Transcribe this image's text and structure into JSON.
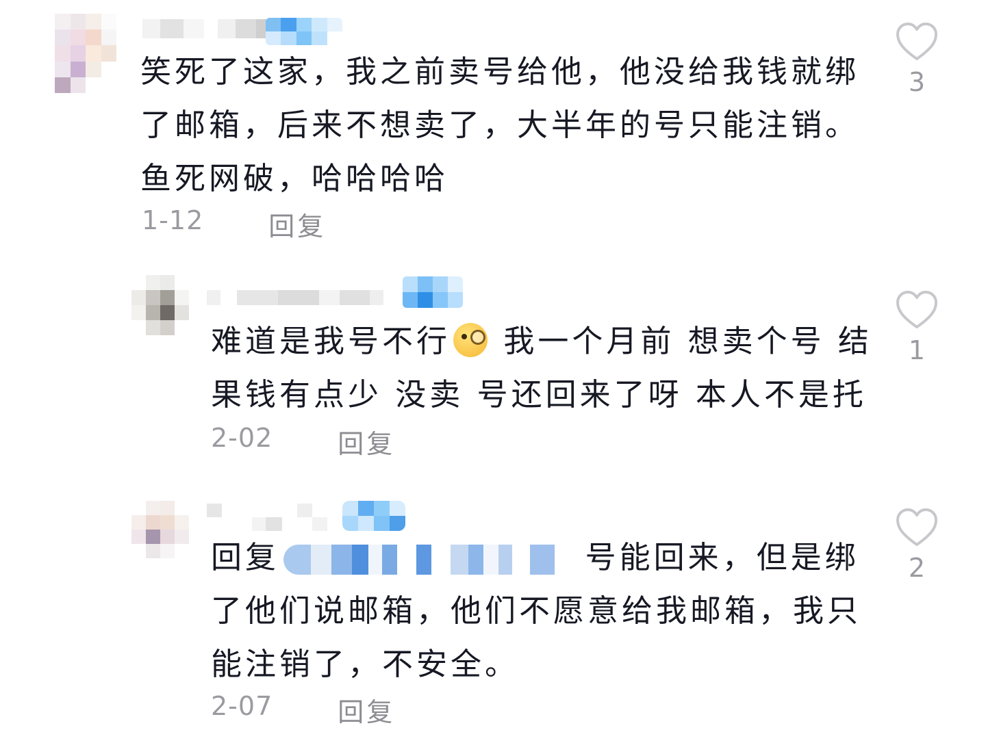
{
  "colors": {
    "text": "#161823",
    "meta": "#9a9aa0",
    "heart": "#c8c8cc",
    "mention_blur": "#3d86e0"
  },
  "comments": [
    {
      "text": "笑死了这家，我之前卖号给他，他没给我钱就绑了邮箱，后来不想卖了，大半年的号只能注销。鱼死网破，哈哈哈哈",
      "date": "1-12",
      "reply_label": "回复",
      "likes": "3"
    },
    {
      "text_before_emoji": "难道是我号不行",
      "emoji": "face-with-monocle",
      "text_after_emoji": " 我一个月前 想卖个号 结果钱有点少 没卖 号还回来了呀 本人不是托",
      "date": "2-02",
      "reply_label": "回复",
      "likes": "1"
    },
    {
      "reply_prefix": "回复",
      "text": "号能回来，但是绑了他们说邮箱，他们不愿意给我邮箱，我只能注销了，不安全。",
      "date": "2-07",
      "reply_label": "回复",
      "likes": "2"
    }
  ],
  "icons": {
    "like": "heart-outline-icon",
    "emoji": "monocle-face-icon"
  }
}
